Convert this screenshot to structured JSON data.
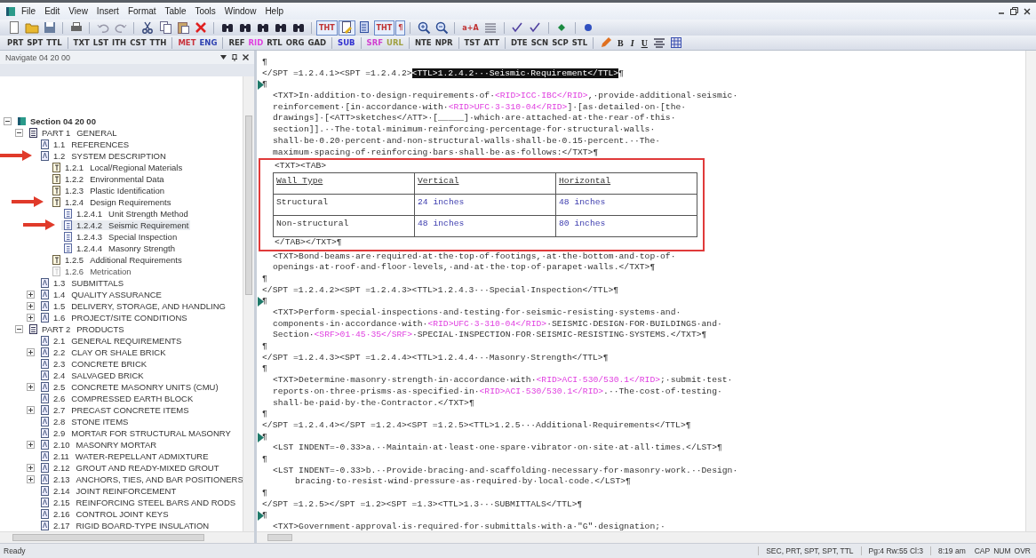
{
  "menu": {
    "items": [
      "File",
      "Edit",
      "View",
      "Insert",
      "Format",
      "Table",
      "Tools",
      "Window",
      "Help"
    ]
  },
  "toolbar": [
    {
      "kind": "new",
      "on": false
    },
    {
      "kind": "open",
      "on": false
    },
    {
      "kind": "save",
      "on": false
    },
    {
      "kind": "separator"
    },
    {
      "kind": "print",
      "on": false
    },
    {
      "kind": "separator"
    },
    {
      "kind": "undo",
      "on": false
    },
    {
      "kind": "redo",
      "on": false
    },
    {
      "kind": "separator"
    },
    {
      "kind": "cut",
      "on": false
    },
    {
      "kind": "copy",
      "on": false
    },
    {
      "kind": "paste",
      "on": false
    },
    {
      "kind": "delete",
      "on": false
    },
    {
      "kind": "separator"
    },
    {
      "kind": "find",
      "on": false
    },
    {
      "kind": "find",
      "on": false
    },
    {
      "kind": "find",
      "on": false
    },
    {
      "kind": "find",
      "on": false
    },
    {
      "kind": "find",
      "on": false
    },
    {
      "kind": "separator"
    },
    {
      "kind": "label",
      "label": "THT",
      "on": true
    },
    {
      "kind": "view",
      "on": true
    },
    {
      "kind": "tagview",
      "on": false
    },
    {
      "kind": "label",
      "label": "THT",
      "on": true
    },
    {
      "kind": "label",
      "label": "¶",
      "on": true
    },
    {
      "kind": "separator"
    },
    {
      "kind": "zoomin",
      "on": false
    },
    {
      "kind": "zoomout",
      "on": false
    },
    {
      "kind": "separator"
    },
    {
      "kind": "label",
      "label": "a+A",
      "on": false
    },
    {
      "kind": "lines",
      "on": false
    },
    {
      "kind": "separator"
    },
    {
      "kind": "check",
      "on": false
    },
    {
      "kind": "check",
      "on": false
    },
    {
      "kind": "separator"
    },
    {
      "kind": "diamond",
      "on": false
    },
    {
      "kind": "separator"
    },
    {
      "kind": "help",
      "on": false
    }
  ],
  "tag_toolbar": [
    {
      "kind": "tag",
      "label": "PRT",
      "color": "#333333"
    },
    {
      "kind": "tag",
      "label": "SPT",
      "color": "#333333"
    },
    {
      "kind": "tag",
      "label": "TTL",
      "color": "#333333"
    },
    {
      "kind": "separator"
    },
    {
      "kind": "tag",
      "label": "TXT",
      "color": "#333333"
    },
    {
      "kind": "tag",
      "label": "LST",
      "color": "#333333"
    },
    {
      "kind": "tag",
      "label": "ITH",
      "color": "#333333"
    },
    {
      "kind": "tag",
      "label": "CST",
      "color": "#333333"
    },
    {
      "kind": "tag",
      "label": "TTH",
      "color": "#333333"
    },
    {
      "kind": "separator"
    },
    {
      "kind": "tag",
      "label": "MET",
      "color": "#c8303a"
    },
    {
      "kind": "tag",
      "label": "ENG",
      "color": "#2c3fb0"
    },
    {
      "kind": "separator"
    },
    {
      "kind": "tag",
      "label": "REF",
      "color": "#333333"
    },
    {
      "kind": "tag",
      "label": "RID",
      "color": "#e040e0"
    },
    {
      "kind": "tag",
      "label": "RTL",
      "color": "#333333"
    },
    {
      "kind": "tag",
      "label": "ORG",
      "color": "#333333"
    },
    {
      "kind": "tag",
      "label": "GAD",
      "color": "#333333"
    },
    {
      "kind": "separator"
    },
    {
      "kind": "tag",
      "label": "SUB",
      "color": "#3030d0"
    },
    {
      "kind": "separator"
    },
    {
      "kind": "tag",
      "label": "SRF",
      "color": "#d040d0"
    },
    {
      "kind": "tag",
      "label": "URL",
      "color": "#a0a040"
    },
    {
      "kind": "separator"
    },
    {
      "kind": "tag",
      "label": "NTE",
      "color": "#333333"
    },
    {
      "kind": "tag",
      "label": "NPR",
      "color": "#333333"
    },
    {
      "kind": "separator"
    },
    {
      "kind": "tag",
      "label": "TST",
      "color": "#333333"
    },
    {
      "kind": "tag",
      "label": "ATT",
      "color": "#333333"
    },
    {
      "kind": "separator"
    },
    {
      "kind": "tag",
      "label": "DTE",
      "color": "#333333"
    },
    {
      "kind": "tag",
      "label": "SCN",
      "color": "#333333"
    },
    {
      "kind": "tag",
      "label": "SCP",
      "color": "#333333"
    },
    {
      "kind": "tag",
      "label": "STL",
      "color": "#333333"
    },
    {
      "kind": "separator"
    },
    {
      "kind": "pencil"
    },
    {
      "kind": "format",
      "label": "B"
    },
    {
      "kind": "format",
      "label": "I"
    },
    {
      "kind": "format",
      "label": "U"
    },
    {
      "kind": "align"
    },
    {
      "kind": "table"
    }
  ],
  "navigator": {
    "title": "Navigate 04 20 00",
    "tree": [
      {
        "kind": "section",
        "label": "Section 04 20 00",
        "expanded": true,
        "selected": false,
        "arrow": false,
        "children": [
          {
            "kind": "part",
            "number": "PART 1",
            "label": "GENERAL",
            "expanded": true,
            "selected": false,
            "arrow": false,
            "children": [
              {
                "kind": "article",
                "number": "1.1",
                "label": "REFERENCES",
                "selected": false,
                "arrow": false
              },
              {
                "kind": "article",
                "number": "1.2",
                "label": "SYSTEM DESCRIPTION",
                "selected": false,
                "arrow": true,
                "children": [
                  {
                    "kind": "paragraph",
                    "number": "1.2.1",
                    "label": "Local/Regional Materials",
                    "selected": false,
                    "arrow": false
                  },
                  {
                    "kind": "paragraph",
                    "number": "1.2.2",
                    "label": "Environmental Data",
                    "selected": false,
                    "arrow": false
                  },
                  {
                    "kind": "paragraph",
                    "number": "1.2.3",
                    "label": "Plastic Identification",
                    "selected": false,
                    "arrow": false
                  },
                  {
                    "kind": "paragraph",
                    "number": "1.2.4",
                    "label": "Design Requirements",
                    "selected": false,
                    "arrow": true,
                    "children": [
                      {
                        "kind": "subparagraph",
                        "number": "1.2.4.1",
                        "label": "Unit Strength Method",
                        "selected": false,
                        "arrow": false
                      },
                      {
                        "kind": "subparagraph",
                        "number": "1.2.4.2",
                        "label": "Seismic Requirement",
                        "selected": true,
                        "arrow": true
                      },
                      {
                        "kind": "subparagraph",
                        "number": "1.2.4.3",
                        "label": "Special Inspection",
                        "selected": false,
                        "arrow": false
                      },
                      {
                        "kind": "subparagraph",
                        "number": "1.2.4.4",
                        "label": "Masonry Strength",
                        "selected": false,
                        "arrow": false
                      }
                    ]
                  },
                  {
                    "kind": "paragraph",
                    "number": "1.2.5",
                    "label": "Additional Requirements",
                    "selected": false,
                    "arrow": false
                  },
                  {
                    "kind": "inactive",
                    "number": "1.2.6",
                    "label": "Metrication",
                    "selected": false,
                    "arrow": false
                  }
                ]
              },
              {
                "kind": "article",
                "number": "1.3",
                "label": "SUBMITTALS",
                "selected": false,
                "arrow": false
              },
              {
                "kind": "article",
                "number": "1.4",
                "label": "QUALITY ASSURANCE",
                "expanded": false,
                "selected": false,
                "arrow": false
              },
              {
                "kind": "article",
                "number": "1.5",
                "label": "DELIVERY, STORAGE, AND HANDLING",
                "expanded": false,
                "selected": false,
                "arrow": false
              },
              {
                "kind": "article",
                "number": "1.6",
                "label": "PROJECT/SITE CONDITIONS",
                "expanded": false,
                "selected": false,
                "arrow": false
              }
            ]
          },
          {
            "kind": "part",
            "number": "PART 2",
            "label": "PRODUCTS",
            "expanded": true,
            "selected": false,
            "arrow": false,
            "children": [
              {
                "kind": "article",
                "number": "2.1",
                "label": "GENERAL REQUIREMENTS",
                "selected": false,
                "arrow": false
              },
              {
                "kind": "article",
                "number": "2.2",
                "label": "CLAY OR SHALE BRICK",
                "expanded": false,
                "selected": false,
                "arrow": false
              },
              {
                "kind": "article",
                "number": "2.3",
                "label": "CONCRETE BRICK",
                "selected": false,
                "arrow": false
              },
              {
                "kind": "article",
                "number": "2.4",
                "label": "SALVAGED BRICK",
                "selected": false,
                "arrow": false
              },
              {
                "kind": "article",
                "number": "2.5",
                "label": "CONCRETE MASONRY UNITS (CMU)",
                "expanded": false,
                "selected": false,
                "arrow": false
              },
              {
                "kind": "article",
                "number": "2.6",
                "label": "COMPRESSED EARTH BLOCK",
                "selected": false,
                "arrow": false
              },
              {
                "kind": "article",
                "number": "2.7",
                "label": "PRECAST CONCRETE ITEMS",
                "expanded": false,
                "selected": false,
                "arrow": false
              },
              {
                "kind": "article",
                "number": "2.8",
                "label": "STONE ITEMS",
                "selected": false,
                "arrow": false
              },
              {
                "kind": "article",
                "number": "2.9",
                "label": "MORTAR FOR STRUCTURAL MASONRY",
                "selected": false,
                "arrow": false
              },
              {
                "kind": "article",
                "number": "2.10",
                "label": "MASONRY MORTAR",
                "expanded": false,
                "selected": false,
                "arrow": false
              },
              {
                "kind": "article",
                "number": "2.11",
                "label": "WATER-REPELLANT ADMIXTURE",
                "selected": false,
                "arrow": false
              },
              {
                "kind": "article",
                "number": "2.12",
                "label": "GROUT AND READY-MIXED GROUT",
                "expanded": false,
                "selected": false,
                "arrow": false
              },
              {
                "kind": "article",
                "number": "2.13",
                "label": "ANCHORS, TIES, AND BAR POSITIONERS",
                "expanded": false,
                "selected": false,
                "arrow": false
              },
              {
                "kind": "article",
                "number": "2.14",
                "label": "JOINT REINFORCEMENT",
                "selected": false,
                "arrow": false
              },
              {
                "kind": "article",
                "number": "2.15",
                "label": "REINFORCING STEEL BARS AND RODS",
                "selected": false,
                "arrow": false
              },
              {
                "kind": "article",
                "number": "2.16",
                "label": "CONTROL JOINT KEYS",
                "selected": false,
                "arrow": false
              },
              {
                "kind": "article",
                "number": "2.17",
                "label": "RIGID BOARD-TYPE INSULATION",
                "selected": false,
                "arrow": false
              }
            ]
          }
        ]
      }
    ]
  },
  "editor": {
    "blocks": [
      {
        "kind": "tag",
        "parts": [
          {
            "kind": "plain",
            "text": "¶"
          }
        ]
      },
      {
        "kind": "tag",
        "parts": [
          {
            "kind": "plain",
            "text": "</SPT =1.2.4.1><SPT =1.2.4.2>"
          },
          {
            "kind": "highlight",
            "text": "<TTL>1.2.4.2···Seismic·Requirement</TTL>"
          },
          {
            "kind": "plain",
            "text": "¶"
          }
        ]
      },
      {
        "kind": "mark",
        "parts": [
          {
            "kind": "plain",
            "text": "¶"
          }
        ]
      },
      {
        "kind": "body",
        "parts": [
          {
            "kind": "plain",
            "text": "<TXT>In·addition·to·design·requirements·of·"
          },
          {
            "kind": "ref",
            "text": "<RID>ICC·IBC</RID>"
          },
          {
            "kind": "plain",
            "text": ",·provide·additional·seismic·"
          }
        ]
      },
      {
        "kind": "body",
        "parts": [
          {
            "kind": "plain",
            "text": "reinforcement·[in·accordance·with·"
          },
          {
            "kind": "ref",
            "text": "<RID>UFC·3-310-04</RID>"
          },
          {
            "kind": "plain",
            "text": "]·[as·detailed·on·[the·"
          }
        ]
      },
      {
        "kind": "body",
        "parts": [
          {
            "kind": "plain",
            "text": "drawings]·[<ATT>sketches</ATT>·[_____]·which·are·attached·at·the·rear·of·this·"
          }
        ]
      },
      {
        "kind": "body",
        "parts": [
          {
            "kind": "plain",
            "text": "section]].··The·total·minimum·reinforcing·percentage·for·structural·walls·"
          }
        ]
      },
      {
        "kind": "body",
        "parts": [
          {
            "kind": "plain",
            "text": "shall·be·0.20·percent·and·non-structural·walls·shall·be·0.15·percent.··The·"
          }
        ]
      },
      {
        "kind": "body",
        "parts": [
          {
            "kind": "plain",
            "text": "maximum·spacing·of·reinforcing·bars·shall·be·as·follows:</TXT>¶"
          }
        ]
      },
      {
        "kind": "callout",
        "blocks": [
          {
            "kind": "body",
            "parts": [
              {
                "kind": "plain",
                "text": "<TXT><TAB>"
              }
            ]
          },
          {
            "kind": "table",
            "columns": [
              "Wall Type",
              "Vertical",
              "Horizontal"
            ],
            "rows": [
              [
                "Structural",
                "24 inches",
                "48 inches"
              ],
              [
                "Non-structural",
                "48 inches",
                "80 inches"
              ]
            ]
          },
          {
            "kind": "body",
            "parts": [
              {
                "kind": "plain",
                "text": "</TAB></TXT>¶"
              }
            ]
          }
        ]
      },
      {
        "kind": "body",
        "parts": [
          {
            "kind": "plain",
            "text": "<TXT>Bond·beams·are·required·at·the·top·of·footings,·at·the·bottom·and·top·of·"
          }
        ]
      },
      {
        "kind": "body",
        "parts": [
          {
            "kind": "plain",
            "text": "openings·at·roof·and·floor·levels,·and·at·the·top·of·parapet·walls.</TXT>¶"
          }
        ]
      },
      {
        "kind": "tag",
        "parts": [
          {
            "kind": "plain",
            "text": "¶"
          }
        ]
      },
      {
        "kind": "tag",
        "parts": [
          {
            "kind": "plain",
            "text": "</SPT =1.2.4.2><SPT =1.2.4.3><TTL>1.2.4.3···Special·Inspection</TTL>¶"
          }
        ]
      },
      {
        "kind": "mark",
        "parts": [
          {
            "kind": "plain",
            "text": "¶"
          }
        ]
      },
      {
        "kind": "body",
        "parts": [
          {
            "kind": "plain",
            "text": "<TXT>Perform·special·inspections·and·testing·for·seismic-resisting·systems·and·"
          }
        ]
      },
      {
        "kind": "body",
        "parts": [
          {
            "kind": "plain",
            "text": "components·in·accordance·with·"
          },
          {
            "kind": "ref",
            "text": "<RID>UFC·3-310-04</RID>"
          },
          {
            "kind": "plain",
            "text": "·SEISMIC·DESIGN·FOR·BUILDINGS·and·"
          }
        ]
      },
      {
        "kind": "body",
        "parts": [
          {
            "kind": "plain",
            "text": "Section·"
          },
          {
            "kind": "ref",
            "text": "<SRF>01·45·35</SRF>"
          },
          {
            "kind": "plain",
            "text": "·SPECIAL·INSPECTION·FOR·SEISMIC-RESISTING·SYSTEMS.</TXT>¶"
          }
        ]
      },
      {
        "kind": "tag",
        "parts": [
          {
            "kind": "plain",
            "text": "¶"
          }
        ]
      },
      {
        "kind": "tag",
        "parts": [
          {
            "kind": "plain",
            "text": "</SPT =1.2.4.3><SPT =1.2.4.4><TTL>1.2.4.4···Masonry·Strength</TTL>¶"
          }
        ]
      },
      {
        "kind": "tag",
        "parts": [
          {
            "kind": "plain",
            "text": "¶"
          }
        ]
      },
      {
        "kind": "body",
        "parts": [
          {
            "kind": "plain",
            "text": "<TXT>Determine·masonry·strength·in·accordance·with·"
          },
          {
            "kind": "ref",
            "text": "<RID>ACI·530/530.1</RID>"
          },
          {
            "kind": "plain",
            "text": ";·submit·test·"
          }
        ]
      },
      {
        "kind": "body",
        "parts": [
          {
            "kind": "plain",
            "text": "reports·on·three·prisms·as·specified·in·"
          },
          {
            "kind": "ref",
            "text": "<RID>ACI·530/530.1</RID>"
          },
          {
            "kind": "plain",
            "text": ".··The·cost·of·testing·"
          }
        ]
      },
      {
        "kind": "body",
        "parts": [
          {
            "kind": "plain",
            "text": "shall·be·paid·by·the·Contractor.</TXT>¶"
          }
        ]
      },
      {
        "kind": "tag",
        "parts": [
          {
            "kind": "plain",
            "text": "¶"
          }
        ]
      },
      {
        "kind": "tag",
        "parts": [
          {
            "kind": "plain",
            "text": "</SPT =1.2.4.4></SPT =1.2.4><SPT =1.2.5><TTL>1.2.5···Additional·Requirements</TTL>¶"
          }
        ]
      },
      {
        "kind": "mark",
        "parts": [
          {
            "kind": "plain",
            "text": "¶"
          }
        ]
      },
      {
        "kind": "body",
        "parts": [
          {
            "kind": "plain",
            "text": "<LST INDENT=-0.33>a.··Maintain·at·least·one·spare·vibrator·on·site·at·all·times.</LST>¶"
          }
        ]
      },
      {
        "kind": "tag",
        "parts": [
          {
            "kind": "plain",
            "text": "¶"
          }
        ]
      },
      {
        "kind": "body",
        "parts": [
          {
            "kind": "plain",
            "text": "<LST INDENT=-0.33>b.··Provide·bracing·and·scaffolding·necessary·for·masonry·work.··Design·"
          }
        ]
      },
      {
        "kind": "cont",
        "parts": [
          {
            "kind": "plain",
            "text": "bracing·to·resist·wind·pressure·as·required·by·local·code.</LST>¶"
          }
        ]
      },
      {
        "kind": "tag",
        "parts": [
          {
            "kind": "plain",
            "text": "¶"
          }
        ]
      },
      {
        "kind": "tag",
        "parts": [
          {
            "kind": "plain",
            "text": "</SPT =1.2.5></SPT =1.2><SPT =1.3><TTL>1.3···SUBMITTALS</TTL>¶"
          }
        ]
      },
      {
        "kind": "mark",
        "parts": [
          {
            "kind": "plain",
            "text": "¶"
          }
        ]
      },
      {
        "kind": "body",
        "parts": [
          {
            "kind": "plain",
            "text": "<TXT>Government·approval·is·required·for·submittals·with·a·\"G\"·designation;·"
          }
        ]
      }
    ]
  },
  "status_bar": {
    "message": "Ready",
    "context": "SEC, PRT, SPT, SPT, TTL",
    "position": "Pg:4 Rw:55 Cl:3",
    "time": "8:19 am",
    "indicators": [
      "CAP",
      "NUM",
      "OVR"
    ]
  }
}
